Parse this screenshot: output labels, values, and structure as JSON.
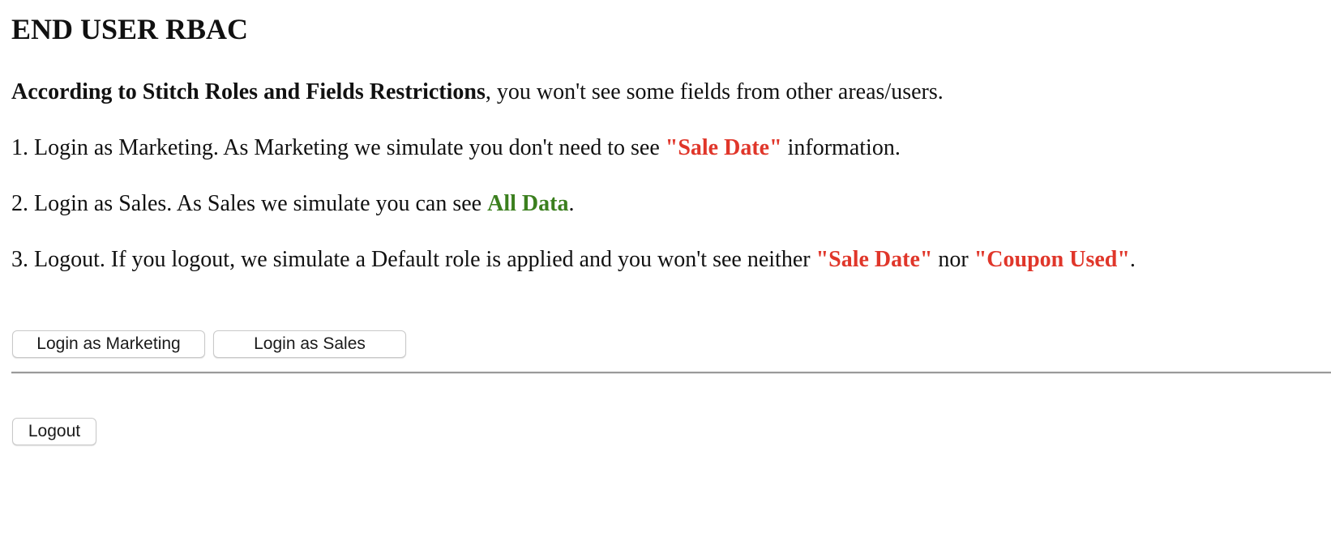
{
  "page": {
    "title": "END USER RBAC"
  },
  "intro": {
    "bold": "According to Stitch Roles and Fields Restrictions",
    "rest": ", you won't see some fields from other areas/users."
  },
  "steps": [
    {
      "before": "1. Login as Marketing. As Marketing we simulate you don't need to see ",
      "highlight": "\"Sale Date\"",
      "after": " information."
    },
    {
      "before": "2. Login as Sales. As Sales we simulate you can see ",
      "highlight": "All Data",
      "after": "."
    },
    {
      "before": "3. Logout. If you logout, we simulate a Default role is applied and you won't see neither ",
      "highlight1": "\"Sale Date\"",
      "middle": " nor ",
      "highlight2": "\"Coupon Used\"",
      "after": "."
    }
  ],
  "buttons": {
    "login_marketing": "Login as Marketing",
    "login_sales": "Login as Sales",
    "logout": "Logout"
  },
  "colors": {
    "restricted": "#e0362a",
    "allowed": "#3b7f1e"
  }
}
